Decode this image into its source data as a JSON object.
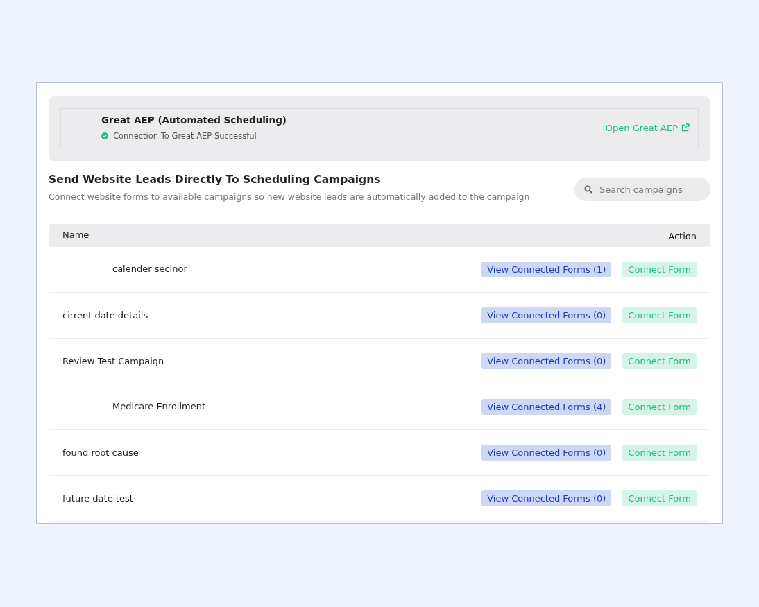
{
  "integration": {
    "title": "Great AEP (Automated Scheduling)",
    "status": "Connection To Great AEP Successful",
    "link": "Open Great AEP"
  },
  "section": {
    "title": "Send Website Leads Directly To Scheduling Campaigns",
    "description": "Connect website forms to available campaigns so new website leads are automatically added to the campaign"
  },
  "search": {
    "placeholder": "Search campaigns"
  },
  "table": {
    "columns": [
      "Name",
      "Action"
    ],
    "rows": [
      {
        "name": "calender secinor",
        "kind": "indented",
        "view": "View Connected Forms (1)",
        "connect": "Connect Form"
      },
      {
        "name": "cirrent date details",
        "kind": "plain",
        "view": "View Connected Forms (0)",
        "connect": "Connect Form"
      },
      {
        "name": "Review Test Campaign",
        "kind": "plain",
        "view": "View Connected Forms (0)",
        "connect": "Connect Form"
      },
      {
        "name": "Medicare Enrollment",
        "kind": "indented",
        "view": "View Connected Forms (4)",
        "connect": "Connect Form"
      },
      {
        "name": "found root cause",
        "kind": "plain",
        "view": "View Connected Forms (0)",
        "connect": "Connect Form"
      },
      {
        "name": "future date test",
        "kind": "plain",
        "view": "View Connected Forms (0)",
        "connect": "Connect Form"
      }
    ]
  }
}
